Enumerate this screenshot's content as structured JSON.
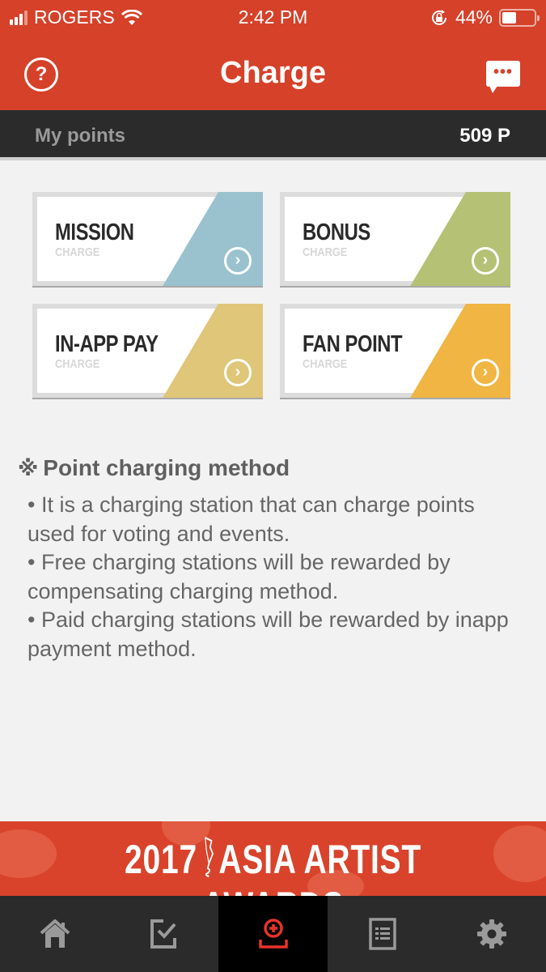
{
  "status_bar": {
    "carrier": "ROGERS",
    "time": "2:42 PM",
    "battery_percent": "44%",
    "battery_level": 0.44
  },
  "header": {
    "title": "Charge",
    "help_icon": "question-circle-icon",
    "chat_icon": "chat-bubble-icon"
  },
  "points": {
    "label": "My points",
    "value": "509 P"
  },
  "cards": [
    {
      "title": "MISSION",
      "subtitle": "CHARGE",
      "color": "#9ac2ce"
    },
    {
      "title": "BONUS",
      "subtitle": "CHARGE",
      "color": "#b5c174"
    },
    {
      "title": "IN-APP PAY",
      "subtitle": "CHARGE",
      "color": "#dfc678"
    },
    {
      "title": "FAN POINT",
      "subtitle": "CHARGE",
      "color": "#f0b542"
    }
  ],
  "info": {
    "mark": "※",
    "heading": "Point charging method",
    "lines": [
      "• It is a charging station that can charge points used for voting and events.",
      "• Free charging stations will be rewarded by compensating charging method.",
      "• Paid charging stations will be rewarded by inapp payment method."
    ]
  },
  "banner": {
    "year": "2017",
    "title": "ASIA ARTIST AWARDS"
  },
  "tabs": [
    {
      "name": "home",
      "icon": "home-icon",
      "active": false
    },
    {
      "name": "vote",
      "icon": "checkbox-icon",
      "active": false
    },
    {
      "name": "charge",
      "icon": "charge-plus-icon",
      "active": true
    },
    {
      "name": "list",
      "icon": "list-document-icon",
      "active": false
    },
    {
      "name": "settings",
      "icon": "gear-icon",
      "active": false
    }
  ],
  "colors": {
    "brand_red": "#d54129",
    "dark_bar": "#2b2b2b",
    "active_tab_icon": "#e8322c",
    "inactive_tab_icon": "#9a9a9a"
  }
}
